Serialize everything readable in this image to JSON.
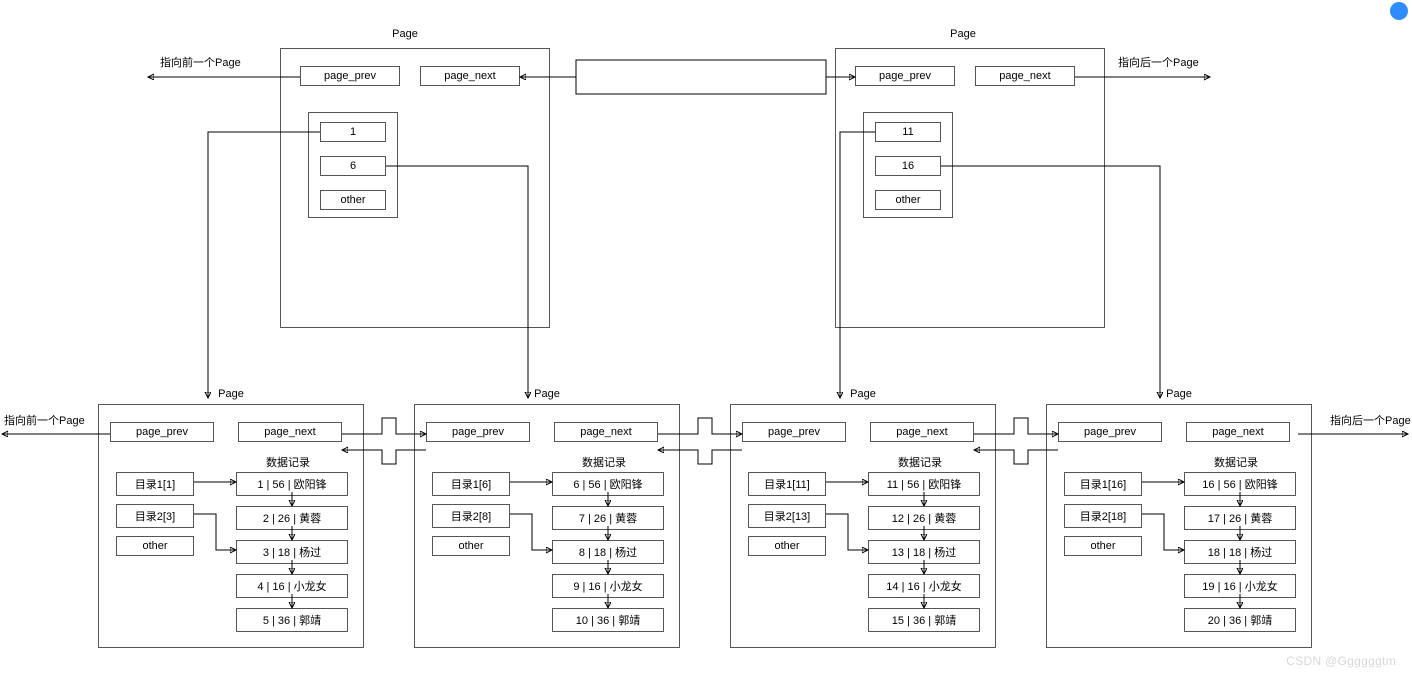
{
  "labels": {
    "page": "Page",
    "page_prev": "page_prev",
    "page_next": "page_next",
    "other": "other",
    "data_section": "数据记录",
    "ptr_prev": "指向前一个Page",
    "ptr_next": "指向后一个Page",
    "watermark": "CSDN @Ggggggtm"
  },
  "top_pages": [
    {
      "dir_entries": [
        "1",
        "6",
        "other"
      ]
    },
    {
      "dir_entries": [
        "11",
        "16",
        "other"
      ]
    }
  ],
  "bottom_pages": [
    {
      "dirs": [
        "目录1[1]",
        "目录2[3]",
        "other"
      ],
      "records": [
        "1 | 56 | 欧阳锋",
        "2 | 26 | 黄蓉",
        "3 | 18 | 杨过",
        "4 | 16 | 小龙女",
        "5 | 36 | 郭靖"
      ]
    },
    {
      "dirs": [
        "目录1[6]",
        "目录2[8]",
        "other"
      ],
      "records": [
        "6 | 56 | 欧阳锋",
        "7 | 26 | 黄蓉",
        "8 | 18 | 杨过",
        "9 | 16 | 小龙女",
        "10 | 36 | 郭靖"
      ]
    },
    {
      "dirs": [
        "目录1[11]",
        "目录2[13]",
        "other"
      ],
      "records": [
        "11 | 56 | 欧阳锋",
        "12 | 26 | 黄蓉",
        "13 | 18 | 杨过",
        "14 | 16 | 小龙女",
        "15 | 36 | 郭靖"
      ]
    },
    {
      "dirs": [
        "目录1[16]",
        "目录2[18]",
        "other"
      ],
      "records": [
        "16 | 56 | 欧阳锋",
        "17 | 26 | 黄蓉",
        "18 | 18 | 杨过",
        "19 | 16 | 小龙女",
        "20 | 36 | 郭靖"
      ]
    }
  ]
}
